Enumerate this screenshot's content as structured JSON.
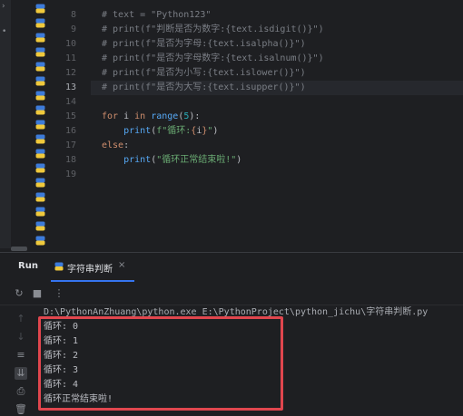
{
  "editor": {
    "first_line_number": 8,
    "current_line": 13,
    "lines": [
      {
        "num": "8",
        "text": "# text = \"Python123\""
      },
      {
        "num": "9",
        "text": "# print(f\"判断是否为数字:{text.isdigit()}\")"
      },
      {
        "num": "10",
        "text": "# print(f\"是否为字母:{text.isalpha()}\")"
      },
      {
        "num": "11",
        "text": "# print(f\"是否为字母数字:{text.isalnum()}\")"
      },
      {
        "num": "12",
        "text": "# print(f\"是否为小写:{text.islower()}\")"
      },
      {
        "num": "13",
        "text": "# print(f\"是否为大写:{text.isupper()}\")"
      },
      {
        "num": "14",
        "text": ""
      },
      {
        "num": "15",
        "text": "for i in range(5):"
      },
      {
        "num": "16",
        "text": "    print(f\"循环:{i}\")"
      },
      {
        "num": "17",
        "text": "else:"
      },
      {
        "num": "18",
        "text": "    print(\"循环正常结束啦!\")"
      },
      {
        "num": "19",
        "text": ""
      }
    ]
  },
  "tool_window": {
    "title": "Run",
    "tab_label": "字符串判断",
    "tab_close": "×"
  },
  "console": {
    "command": "D:\\PythonAnZhuang\\python.exe E:\\PythonProject\\python_jichu\\字符串判断.py",
    "output": [
      "循环: 0",
      "循环: 1",
      "循环: 2",
      "循环: 3",
      "循环: 4",
      "循环正常结束啦!"
    ]
  },
  "icons": {
    "python_file": "python-file-icon",
    "rerun": "rerun-icon",
    "stop": "stop-icon",
    "more": "more-icon",
    "up": "arrow-up-icon",
    "down": "arrow-down-icon",
    "wrap": "soft-wrap-icon",
    "scroll_end": "scroll-to-end-icon",
    "print": "print-icon",
    "trash": "trash-icon"
  },
  "colors": {
    "highlight_box": "#e0464e",
    "tab_underline": "#3574f0"
  }
}
